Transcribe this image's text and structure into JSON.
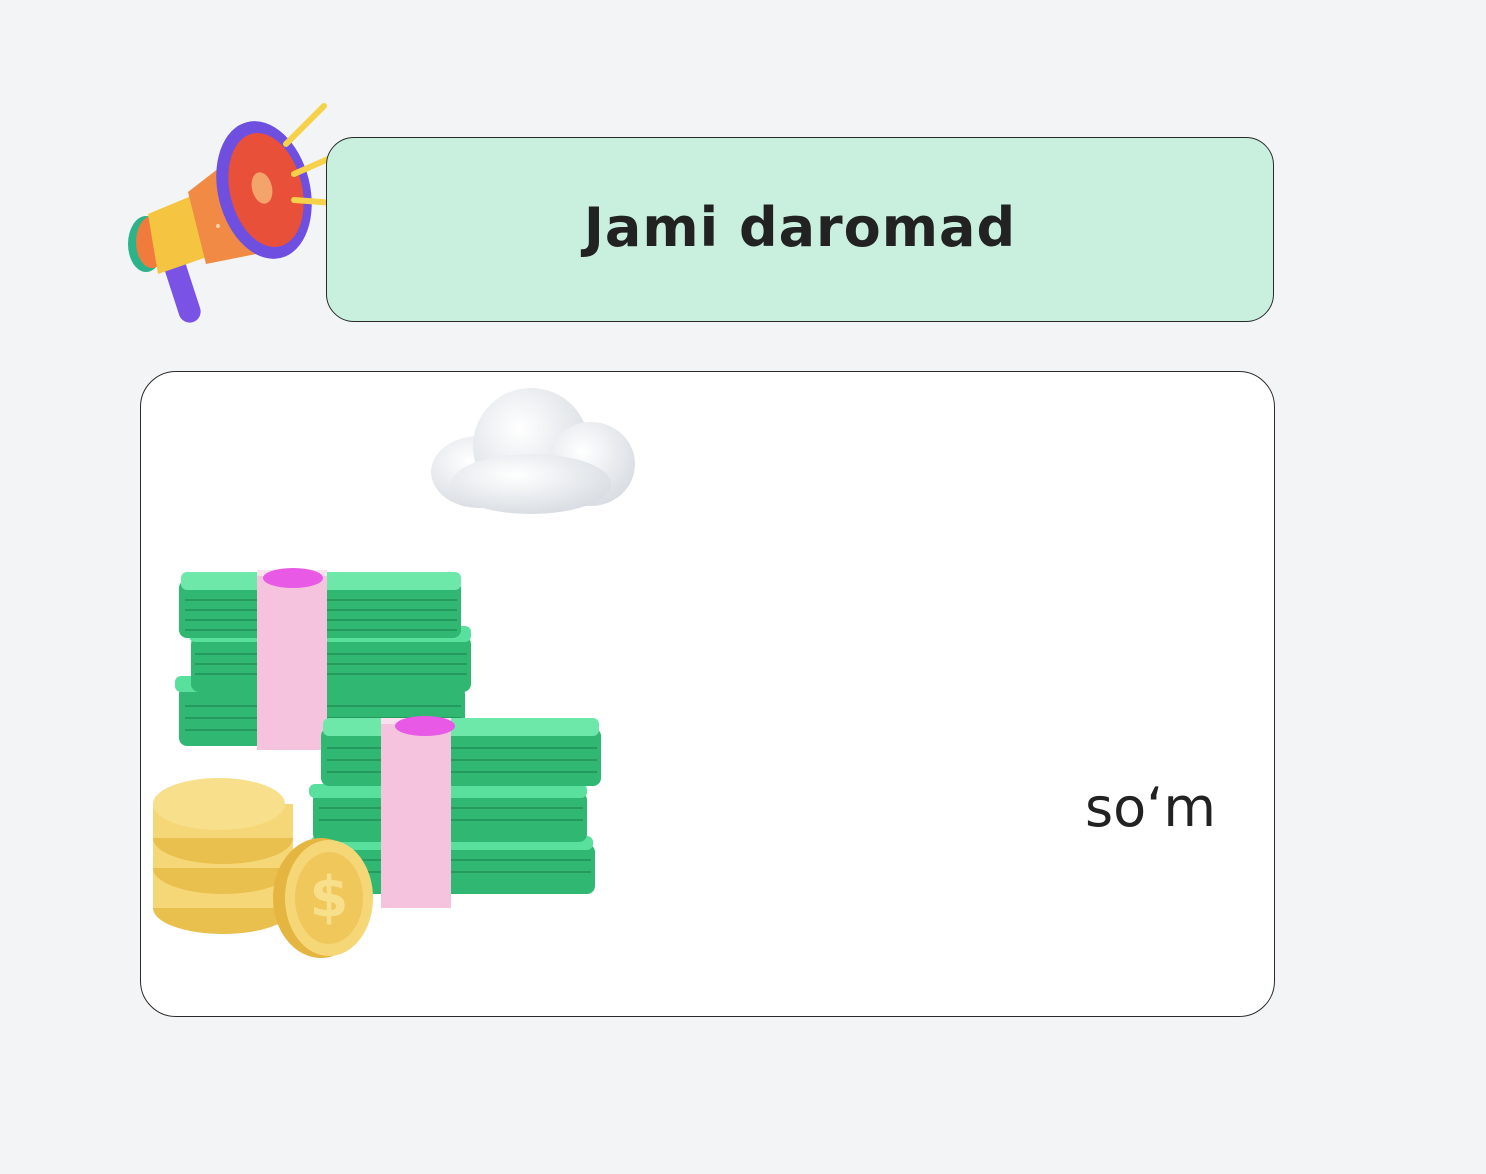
{
  "header": {
    "title": "Jami daromad",
    "icon": "megaphone-icon"
  },
  "card": {
    "currency": "so‘m",
    "decorations": [
      "cloud-illustration",
      "money-stack-illustration",
      "coin-stack-illustration"
    ]
  },
  "colors": {
    "page_background": "#f2f4f6",
    "banner_background": "#c9f0de",
    "card_background": "#ffffff",
    "border": "#2a2a2a",
    "bill_green": "#3fcf85",
    "bill_band": "#f6c3df",
    "dollar_mark": "#e85ae6",
    "coin": "#f6d777"
  }
}
